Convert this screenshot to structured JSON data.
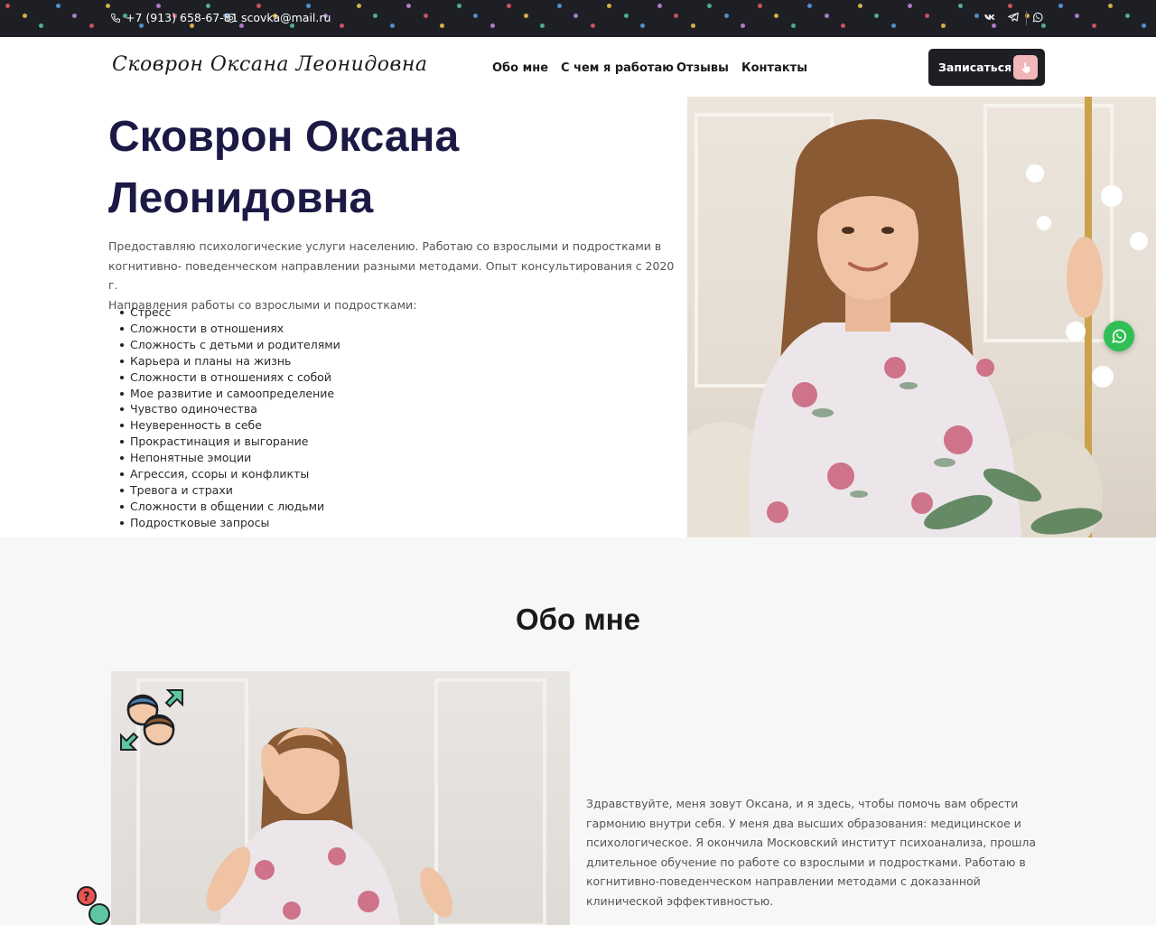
{
  "topbar": {
    "phone": "+7 (913) 658-67-81",
    "email": "scovka@mail.ru",
    "social": [
      {
        "icon": "vk-icon"
      },
      {
        "icon": "telegram-icon"
      },
      {
        "icon": "whatsapp-icon"
      }
    ]
  },
  "header": {
    "logo": "Сковрон Оксана Леонидовна",
    "nav": [
      "Обо мне",
      "С чем я работаю",
      "Отзывы",
      "Контакты"
    ],
    "cta_label": "Записаться",
    "cta_icon": "pointer-hand-icon"
  },
  "hero": {
    "title_line1": "Сковрон Оксана",
    "title_line2": "Леонидовна",
    "text_line1": "Предоставляю психологические услуги населению. Работаю со взрослыми и подростками в",
    "text_line2": "когнитивно- поведенческом направлении разными методами. Опыт консультирования с 2020 г.",
    "text_line3": "Направления работы со взрослыми и подростками:",
    "directions": [
      "Стресс",
      "Сложности в отношениях",
      "Сложность с детьми и родителями",
      "Карьера и планы на жизнь",
      "Сложности в отношениях с собой",
      "Мое развитие и самоопределение",
      "Чувство одиночества",
      "Неуверенность в себе",
      "Прокрастинация и выгорание",
      "Непонятные эмоции",
      "Агрессия, ссоры и конфликты",
      "Тревога и страхи",
      "Сложности в общении с людьми",
      "Подростковые запросы"
    ]
  },
  "floating_button": {
    "icon": "whatsapp-icon"
  },
  "about": {
    "title": "Обо мне",
    "lines": [
      "Здравствуйте, меня зовут Оксана, и я здесь, чтобы помочь вам обрести",
      "гармонию внутри себя. У меня два высших образования: медицинское и",
      "психологическое. Я окончила Московский институт психоанализа, прошла",
      "длительное обучение по работе со взрослыми и подростками. Работаю в",
      "когнитивно-поведенческом направлении методами с доказанной",
      "клинической эффективностью."
    ]
  },
  "colors": {
    "topbar_bg": "#1d1f24",
    "title_color": "#1c1a45",
    "cta_bg": "#1d1f24",
    "cta_icon_bg": "#f0b6b8",
    "whatsapp_green": "#2fbf55",
    "about_bg": "#f7f7f8"
  }
}
